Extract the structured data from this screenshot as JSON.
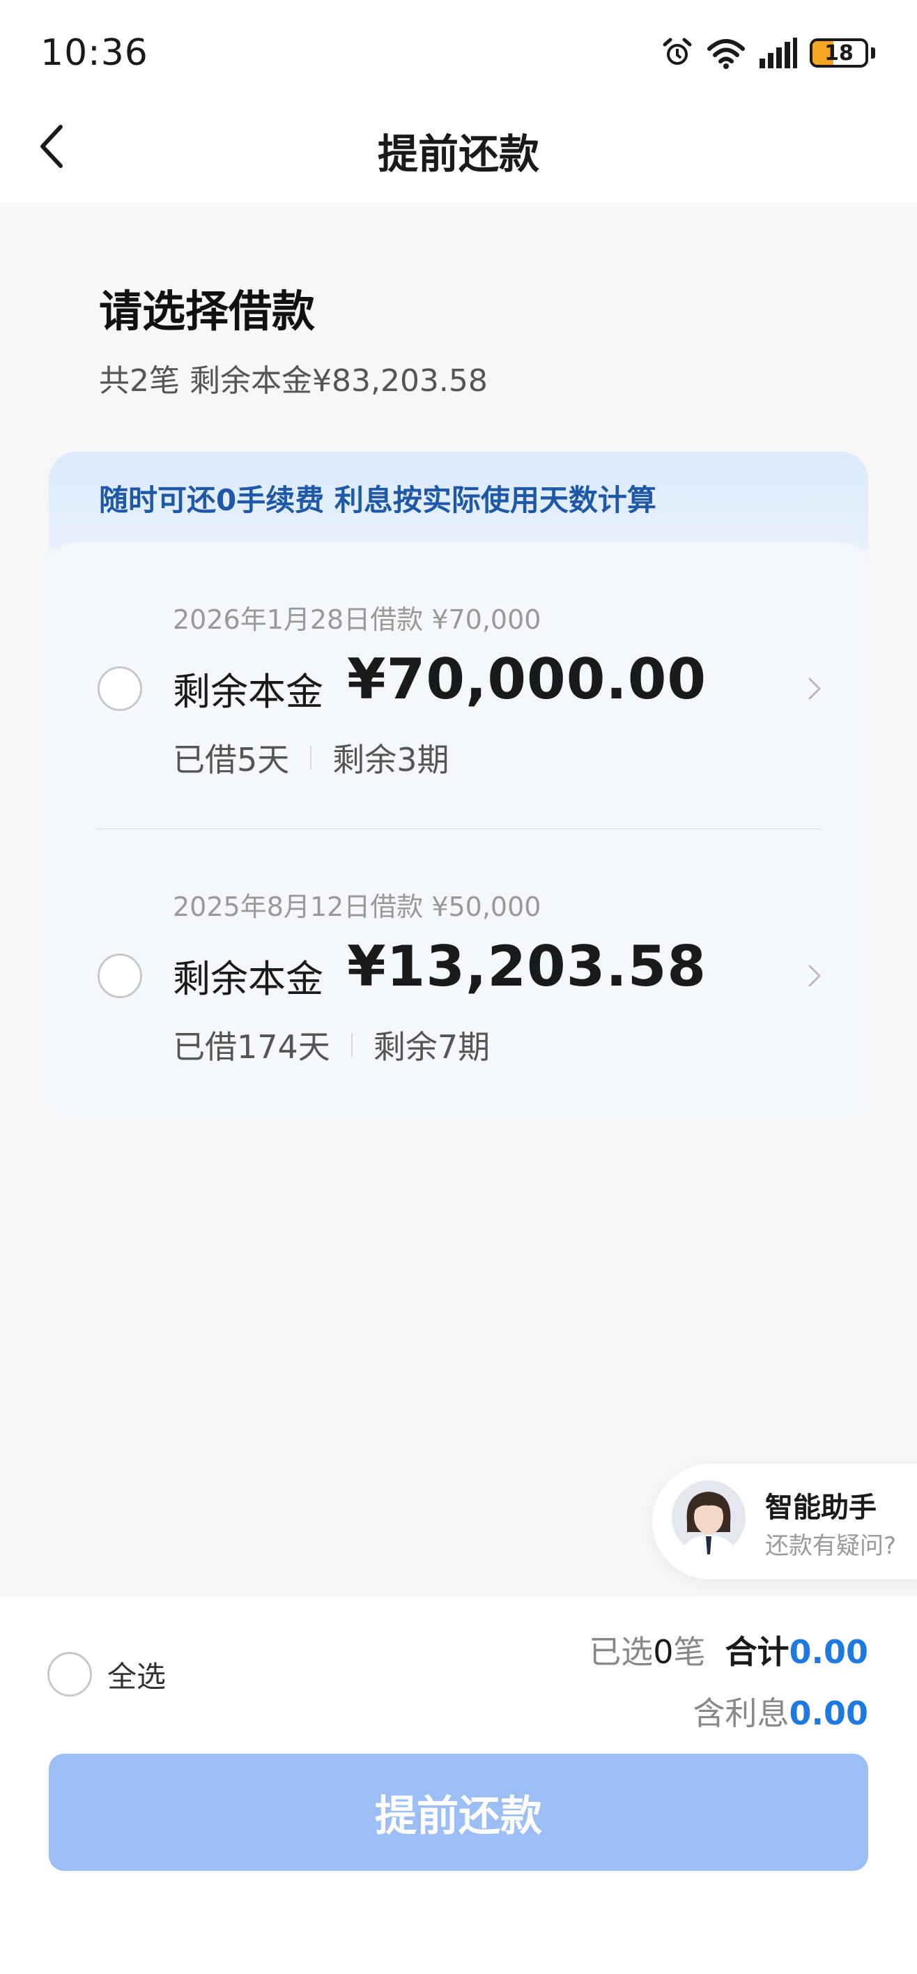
{
  "status_bar": {
    "time": "10:36",
    "battery": "18"
  },
  "nav": {
    "title": "提前还款"
  },
  "header": {
    "title": "请选择借款",
    "subtitle": "共2笔 剩余本金¥83,203.58"
  },
  "card": {
    "banner": "随时可还0手续费 利息按实际使用天数计算",
    "loans": [
      {
        "date": "2026年1月28日借款 ¥70,000",
        "label": "剩余本金",
        "amount": "¥70,000.00",
        "borrowed": "已借5天",
        "remaining": "剩余3期"
      },
      {
        "date": "2025年8月12日借款 ¥50,000",
        "label": "剩余本金",
        "amount": "¥13,203.58",
        "borrowed": "已借174天",
        "remaining": "剩余7期"
      }
    ]
  },
  "assistant": {
    "title": "智能助手",
    "subtitle": "还款有疑问?"
  },
  "footer": {
    "select_all": "全选",
    "selected_prefix": "已选",
    "selected_count": "0",
    "selected_suffix": "笔",
    "total_label": "合计",
    "total_value": "0.00",
    "interest_label": "含利息",
    "interest_value": "0.00",
    "submit_label": "提前还款"
  },
  "colors": {
    "accent": "#1f7ae0",
    "button": "#9dbdf5",
    "banner_text": "#1e58a6"
  }
}
